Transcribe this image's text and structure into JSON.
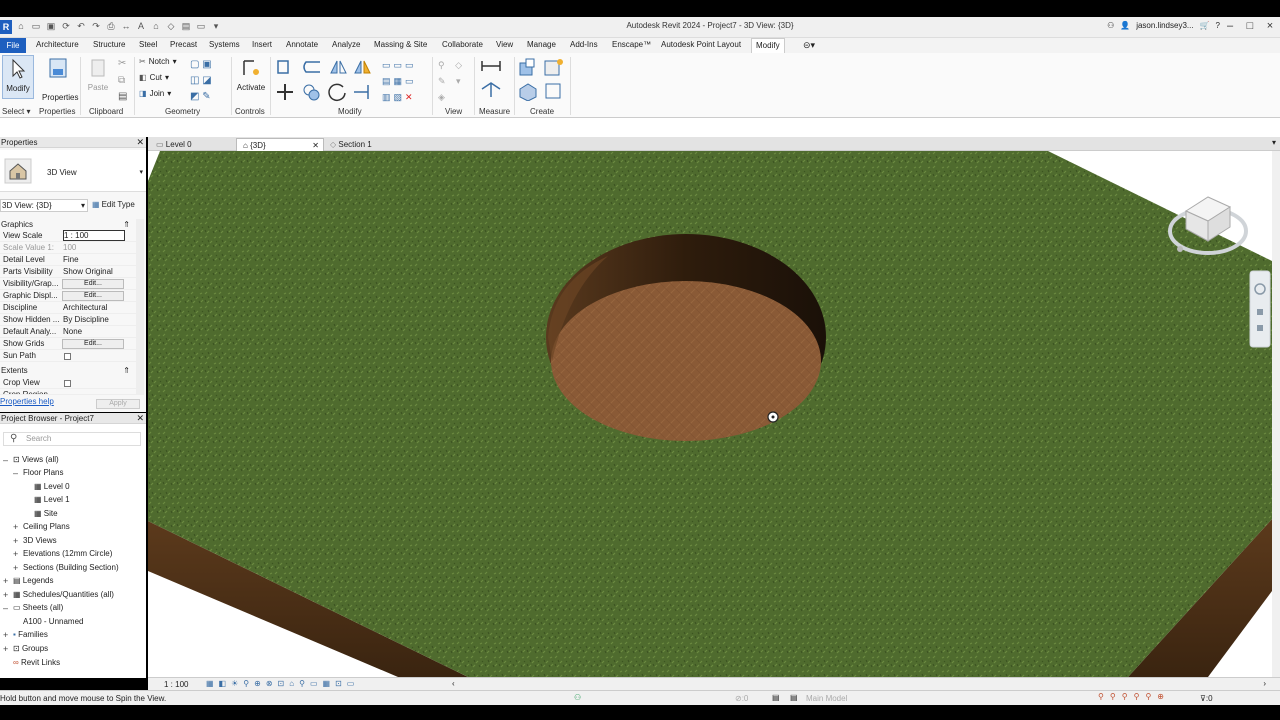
{
  "window": {
    "title": "Autodesk Revit 2024 - Project7 - 3D View: {3D}",
    "app_badge": "R",
    "user": "jason.lindsey3..."
  },
  "menu": {
    "file": "File",
    "items": [
      "Architecture",
      "Structure",
      "Steel",
      "Precast",
      "Systems",
      "Insert",
      "Annotate",
      "Analyze",
      "Massing & Site",
      "Collaborate",
      "View",
      "Manage",
      "Add-Ins",
      "Enscape™",
      "Autodesk Point Layout",
      "Modify"
    ],
    "active": "Modify"
  },
  "ribbon": {
    "modify_label": "Modify",
    "properties_label": "Properties",
    "paste_label": "Paste",
    "notch_label": "Notch",
    "cut_label": "Cut",
    "join_label": "Join",
    "activate_label": "Activate",
    "groups": {
      "select": "Select",
      "properties": "Properties",
      "clipboard": "Clipboard",
      "geometry": "Geometry",
      "controls": "Controls",
      "modify": "Modify",
      "view": "View",
      "measure": "Measure",
      "create": "Create"
    }
  },
  "properties": {
    "title": "Properties",
    "type_name": "3D View",
    "selector": "3D View: {3D}",
    "edit_type": "Edit Type",
    "graphics_header": "Graphics",
    "rows": [
      {
        "key": "View Scale",
        "value": "1 : 100"
      },
      {
        "key": "Scale Value    1:",
        "value": "100"
      },
      {
        "key": "Detail Level",
        "value": "Fine"
      },
      {
        "key": "Parts Visibility",
        "value": "Show Original"
      },
      {
        "key": "Visibility/Grap...",
        "value": "Edit..."
      },
      {
        "key": "Graphic Displ...",
        "value": "Edit..."
      },
      {
        "key": "Discipline",
        "value": "Architectural"
      },
      {
        "key": "Show Hidden ...",
        "value": "By Discipline"
      },
      {
        "key": "Default Analy...",
        "value": "None"
      },
      {
        "key": "Show Grids",
        "value": "Edit..."
      },
      {
        "key": "Sun Path",
        "value": ""
      }
    ],
    "extents_header": "Extents",
    "extents_rows": [
      {
        "key": "Crop View",
        "value": ""
      },
      {
        "key": "Crop Region ...",
        "value": ""
      }
    ],
    "help_link": "Properties help",
    "apply": "Apply"
  },
  "browser": {
    "title": "Project Browser - Project7",
    "search_placeholder": "Search",
    "items": {
      "views_all": "Views (all)",
      "floor_plans": "Floor Plans",
      "level0": "Level 0",
      "level1": "Level 1",
      "site": "Site",
      "ceiling_plans": "Ceiling Plans",
      "views3d": "3D Views",
      "elevations": "Elevations (12mm Circle)",
      "sections": "Sections (Building Section)",
      "legends": "Legends",
      "schedules": "Schedules/Quantities (all)",
      "sheets": "Sheets (all)",
      "a100": "A100 - Unnamed",
      "families": "Families",
      "groups": "Groups",
      "revit_links": "Revit Links"
    }
  },
  "tabs": [
    {
      "label": "Level 0"
    },
    {
      "label": "{3D}"
    },
    {
      "label": "Section 1"
    }
  ],
  "viewbar": {
    "scale": "1 : 100"
  },
  "status": {
    "hint": "Hold button and move mouse to Spin the View.",
    "zero": ":0",
    "model": "Main Model",
    "filter_count": ":0"
  },
  "colors": {
    "grass": "#4f6b2e",
    "dirt": "#8a5a36",
    "revit_blue": "#1e5fbf"
  }
}
